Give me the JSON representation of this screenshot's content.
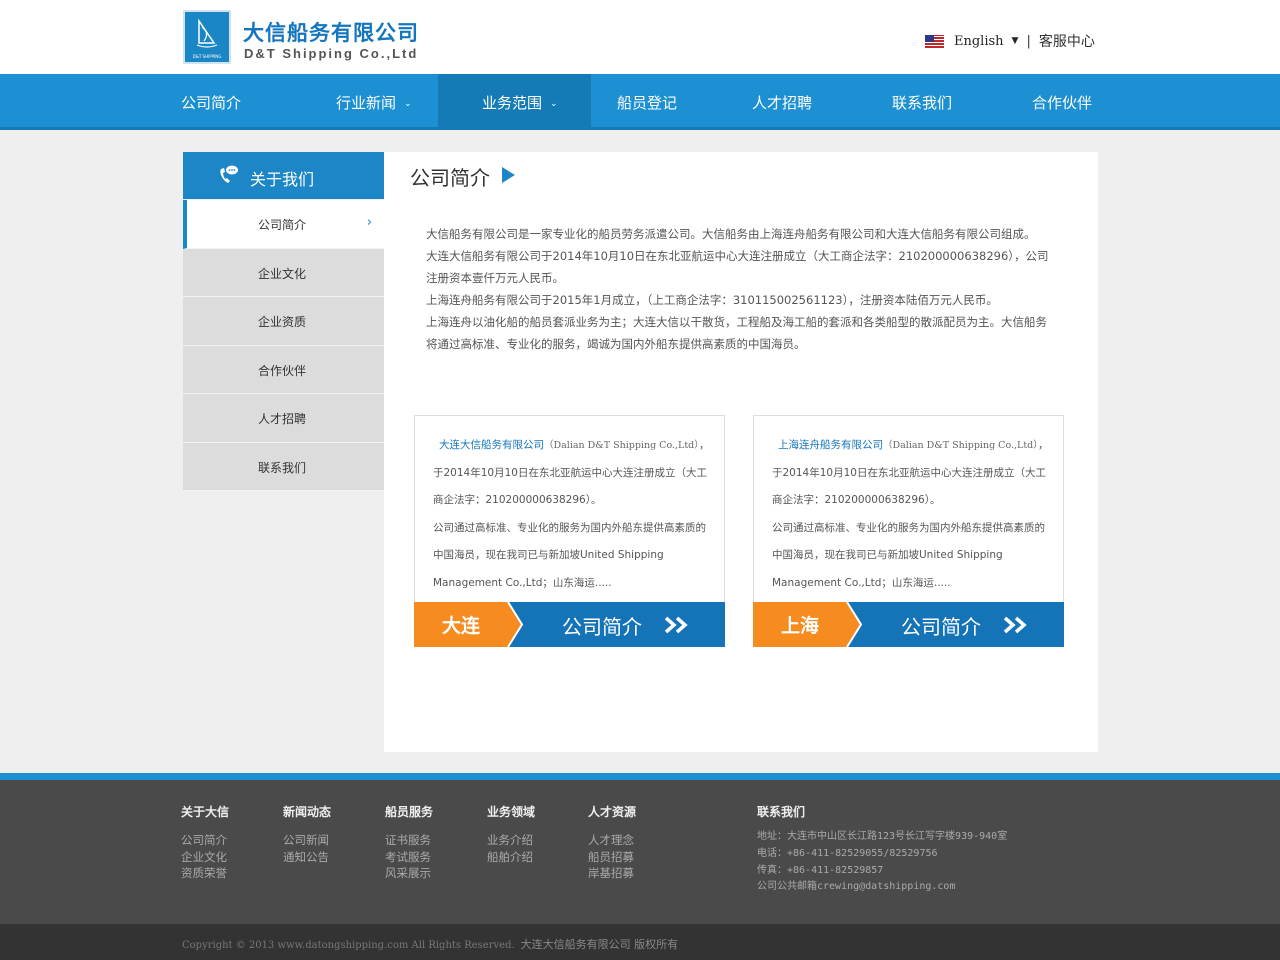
{
  "header": {
    "logo_sub": "D&T SHIPPING",
    "brand_cn": "大信船务有限公司",
    "brand_en": "D&T Shipping Co.,Ltd",
    "language": "English",
    "separator": "|",
    "service_center": "客服中心"
  },
  "nav": {
    "items": [
      {
        "label": "公司简介"
      },
      {
        "label": "行业新闻",
        "dropdown": "⌄"
      },
      {
        "label": "业务范围",
        "dropdown": "⌄"
      },
      {
        "label": "船员登记"
      },
      {
        "label": "人才招聘"
      },
      {
        "label": "联系我们"
      },
      {
        "label": "合作伙伴"
      }
    ],
    "active_index": 2
  },
  "sidebar": {
    "title": "关于我们",
    "items": [
      {
        "label": "公司简介",
        "active": true
      },
      {
        "label": "企业文化"
      },
      {
        "label": "企业资质"
      },
      {
        "label": "合作伙伴"
      },
      {
        "label": "人才招聘"
      },
      {
        "label": "联系我们"
      }
    ],
    "chevron": "›"
  },
  "content": {
    "title": "公司简介",
    "paragraphs": [
      "大信船务有限公司是一家专业化的船员劳务派遣公司。大信船务由上海连舟船务有限公司和大连大信船务有限公司组成。",
      "大连大信船务有限公司于2014年10月10日在东北亚航运中心大连注册成立（大工商企法字：210200000638296），公司注册资本壹仟万元人民币。",
      "上海连舟船务有限公司于2015年1月成立，（上工商企法字：310115002561123），注册资本陆佰万元人民币。",
      "上海连舟以油化船的船员套派业务为主；大连大信以干散货，工程船及海工船的套派和各类船型的散派配员为主。大信船务将通过高标准、专业化的服务，竭诚为国内外船东提供高素质的中国海员。"
    ],
    "cards": [
      {
        "company": "大连大信船务有限公司",
        "en_name": "（Dalian D&T Shipping Co.,Ltd）",
        "text1": "，于2014年10月10日在东北亚航运中心大连注册成立（大工商企法字：210200000638296）。",
        "text2": "公司通过高标准、专业化的服务为国内外船东提供高素质的中国海员，现在我司已与新加坡United Shipping Management Co.,Ltd；山东海运.....",
        "city": "大连",
        "button": "公司简介"
      },
      {
        "company": "上海连舟船务有限公司",
        "en_name": "（Dalian D&T Shipping Co.,Ltd）",
        "text1": "，于2014年10月10日在东北亚航运中心大连注册成立（大工商企法字：210200000638296）。",
        "text2": "公司通过高标准、专业化的服务为国内外船东提供高素质的中国海员，现在我司已与新加坡United Shipping Management Co.,Ltd；山东海运.....",
        "city": "上海",
        "button": "公司简介"
      }
    ]
  },
  "footer": {
    "columns": [
      {
        "heading": "关于大信",
        "links": [
          "公司简介",
          "企业文化",
          "资质荣誉"
        ]
      },
      {
        "heading": "新闻动态",
        "links": [
          "公司新闻",
          "通知公告"
        ]
      },
      {
        "heading": "船员服务",
        "links": [
          "证书服务",
          "考试服务",
          "风采展示"
        ]
      },
      {
        "heading": "业务领域",
        "links": [
          "业务介绍",
          "船舶介绍"
        ]
      },
      {
        "heading": "人才资源",
        "links": [
          "人才理念",
          "船员招募",
          "岸基招募"
        ]
      }
    ],
    "contact": {
      "heading": "联系我们",
      "address": "地址：大连市中山区长江路123号长江写字楼939-940室",
      "phone": "电话：+86-411-82529055/82529756",
      "fax": "传真：+86-411-82529857",
      "email": "公司公共邮箱crewing@datshipping.com"
    },
    "copyright": "Copyright © 2013 www.datongshipping.com All Rights Reserved.",
    "copyright_cn": "大连大信船务有限公司 版权所有"
  },
  "colors": {
    "accent_blue": "#1c90d2",
    "orange": "#f68b1f",
    "footer_bg": "#4a4a4a"
  }
}
